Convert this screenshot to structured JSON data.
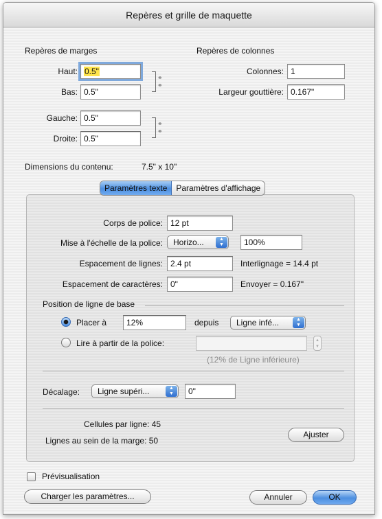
{
  "window": {
    "title": "Repères et grille de maquette"
  },
  "margins": {
    "heading": "Repères de marges",
    "haut_label": "Haut:",
    "haut_value": "0.5\"",
    "bas_label": "Bas:",
    "bas_value": "0.5\"",
    "gauche_label": "Gauche:",
    "gauche_value": "0.5\"",
    "droite_label": "Droite:",
    "droite_value": "0.5\""
  },
  "columns": {
    "heading": "Repères de colonnes",
    "colonnes_label": "Colonnes:",
    "colonnes_value": "1",
    "gouttiere_label": "Largeur gouttière:",
    "gouttiere_value": "0.167\""
  },
  "content_dims": {
    "label": "Dimensions du contenu:",
    "value": "7.5\" x 10\""
  },
  "tabs": [
    {
      "label": "Paramètres texte",
      "active": true
    },
    {
      "label": "Paramètres d'affichage",
      "active": false
    }
  ],
  "text_settings": {
    "corps_label": "Corps de police:",
    "corps_value": "12 pt",
    "echelle_label": "Mise à l'échelle de la police:",
    "echelle_select": "Horizo...",
    "echelle_value": "100%",
    "espacement_lignes_label": "Espacement de lignes:",
    "espacement_lignes_value": "2.4 pt",
    "interlignage_text": "Interlignage = 14.4 pt",
    "espacement_car_label": "Espacement de caractères:",
    "espacement_car_value": "0\"",
    "envoyer_text": "Envoyer = 0.167\""
  },
  "baseline": {
    "heading": "Position de ligne de base",
    "placer_label": "Placer à",
    "placer_value": "12%",
    "depuis_label": "depuis",
    "depuis_select": "Ligne infé...",
    "lire_label": "Lire à partir de la police:",
    "lire_value": "",
    "hint": "(12% de Ligne inférieure)",
    "selected": "placer"
  },
  "offset": {
    "label": "Décalage:",
    "select": "Ligne supéri...",
    "value": "0\""
  },
  "stats": {
    "cellules": "Cellules par ligne: 45",
    "lignes": "Lignes au sein de la marge: 50",
    "ajuster_label": "Ajuster"
  },
  "footer": {
    "preview_label": "Prévisualisation",
    "preview_checked": false,
    "charger_label": "Charger les paramètres...",
    "annuler_label": "Annuler",
    "ok_label": "OK"
  },
  "colors": {
    "accent": "#4d8fe0",
    "focus_highlight": "#ffe44c"
  }
}
